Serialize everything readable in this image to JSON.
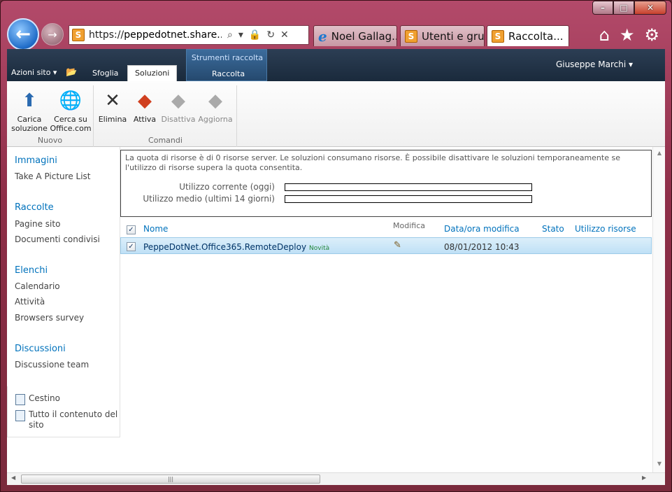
{
  "browser": {
    "address_prefix": "https://",
    "address_domain": "peppedotnet.share...",
    "tabs": [
      {
        "label": "Noel Gallag...",
        "icon": "ie-icon"
      },
      {
        "label": "Utenti e gru...",
        "icon": "sharepoint-icon"
      },
      {
        "label": "Raccolta...",
        "icon": "sharepoint-icon",
        "active": true
      }
    ],
    "caption": {
      "minimize": "–",
      "maximize": "□",
      "close": "✕"
    }
  },
  "ribbon": {
    "site_actions": "Azioni sito ▾",
    "tabs": [
      "Sfoglia",
      "Soluzioni",
      "Raccolta"
    ],
    "context_group": "Strumenti raccolta",
    "user": "Giuseppe Marchi ▾",
    "groups": [
      {
        "label": "Nuovo",
        "buttons": [
          {
            "label": "Carica\nsoluzione",
            "icon": "upload-solution-icon",
            "enabled": true
          },
          {
            "label": "Cerca su\nOffice.com",
            "icon": "globe-icon",
            "enabled": true
          }
        ]
      },
      {
        "label": "Comandi",
        "buttons": [
          {
            "label": "Elimina",
            "icon": "delete-icon",
            "enabled": true
          },
          {
            "label": "Attiva",
            "icon": "activate-icon",
            "enabled": true
          },
          {
            "label": "Disattiva",
            "icon": "deactivate-icon",
            "enabled": false
          },
          {
            "label": "Aggiorna",
            "icon": "upgrade-icon",
            "enabled": false
          }
        ]
      }
    ]
  },
  "leftnav": {
    "sections": [
      {
        "heading": "Immagini",
        "items": [
          "Take A Picture List"
        ]
      },
      {
        "heading": "Raccolte",
        "items": [
          "Pagine sito",
          "Documenti condivisi"
        ]
      },
      {
        "heading": "Elenchi",
        "items": [
          "Calendario",
          "Attività",
          "Browsers survey"
        ]
      },
      {
        "heading": "Discussioni",
        "items": [
          "Discussione team"
        ]
      }
    ],
    "bottom": [
      {
        "label": "Cestino",
        "icon": "recycle-bin-icon"
      },
      {
        "label": "Tutto il contenuto del sito",
        "icon": "all-content-icon"
      }
    ]
  },
  "quota": {
    "text": "La quota di risorse è di 0 risorse server. Le soluzioni consumano risorse. È possibile disattivare le soluzioni temporaneamente se l'utilizzo di risorse supera la quota consentita.",
    "current_label": "Utilizzo corrente (oggi)",
    "average_label": "Utilizzo medio (ultimi 14 giorni)",
    "current_fill": 0,
    "average_fill": 0
  },
  "solutions": {
    "columns": [
      "Nome",
      "Modifica",
      "Data/ora modifica",
      "Stato",
      "Utilizzo risorse"
    ],
    "rows": [
      {
        "name": "PeppeDotNet.Office365.RemoteDeploy",
        "badge": "Novità",
        "modified": "08/01/2012 10:43",
        "status": "",
        "usage": ""
      }
    ]
  }
}
